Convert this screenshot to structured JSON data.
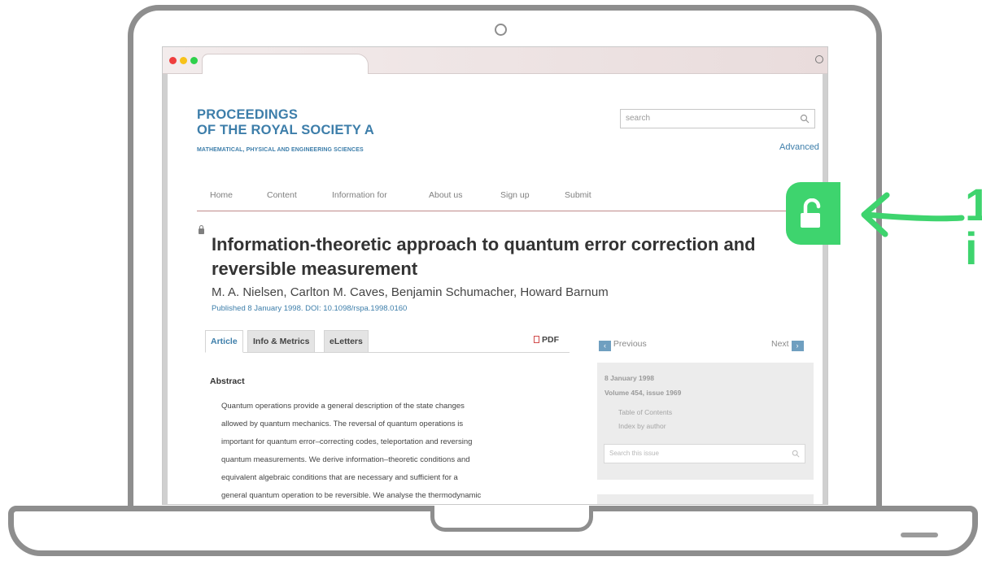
{
  "journal": {
    "title_line1": "PROCEEDINGS",
    "title_line2": "OF THE ROYAL SOCIETY A",
    "subtitle": "MATHEMATICAL, PHYSICAL AND ENGINEERING SCIENCES"
  },
  "search": {
    "placeholder": "search",
    "advanced_label": "Advanced"
  },
  "nav": {
    "items": [
      "Home",
      "Content",
      "Information for",
      "About us",
      "Sign up",
      "Submit"
    ]
  },
  "article": {
    "title": "Information-theoretic approach to quantum error correction and reversible measurement",
    "authors": "M. A. Nielsen, Carlton M. Caves, Benjamin Schumacher, Howard Barnum",
    "published": "Published 8 January 1998. DOI: 10.1098/rspa.1998.0160"
  },
  "tabs": {
    "items": [
      "Article",
      "Info & Metrics",
      "eLetters"
    ],
    "active": "Article",
    "pdf_label": "PDF"
  },
  "abstract": {
    "heading": "Abstract",
    "lines": [
      "Quantum operations provide a general description of the state changes",
      "allowed by quantum mechanics. The reversal of quantum operations is",
      "important for quantum error–correcting codes, teleportation and reversing",
      "quantum measurements. We derive information–theoretic conditions and",
      "equivalent algebraic conditions that are necessary and sufficient for a",
      "general quantum operation to be reversible. We analyse the thermodynamic"
    ]
  },
  "sidebar": {
    "previous_label": "Previous",
    "next_label": "Next",
    "issue_date": "8 January 1998",
    "issue_volume": "Volume 454, issue 1969",
    "toc_label": "Table of Contents",
    "index_label": "Index by author",
    "issue_search_placeholder": "Search this issue"
  },
  "colors": {
    "accent": "#3d7eaa",
    "callout_green": "#3ed46e",
    "laptop_outline": "#8e8e8e"
  },
  "icons": [
    "search-icon",
    "lock-icon",
    "pdf-icon",
    "unlock-icon",
    "arrow-left-icon",
    "chevron-left-icon",
    "chevron-right-icon",
    "camera-icon",
    "profile-icon"
  ]
}
